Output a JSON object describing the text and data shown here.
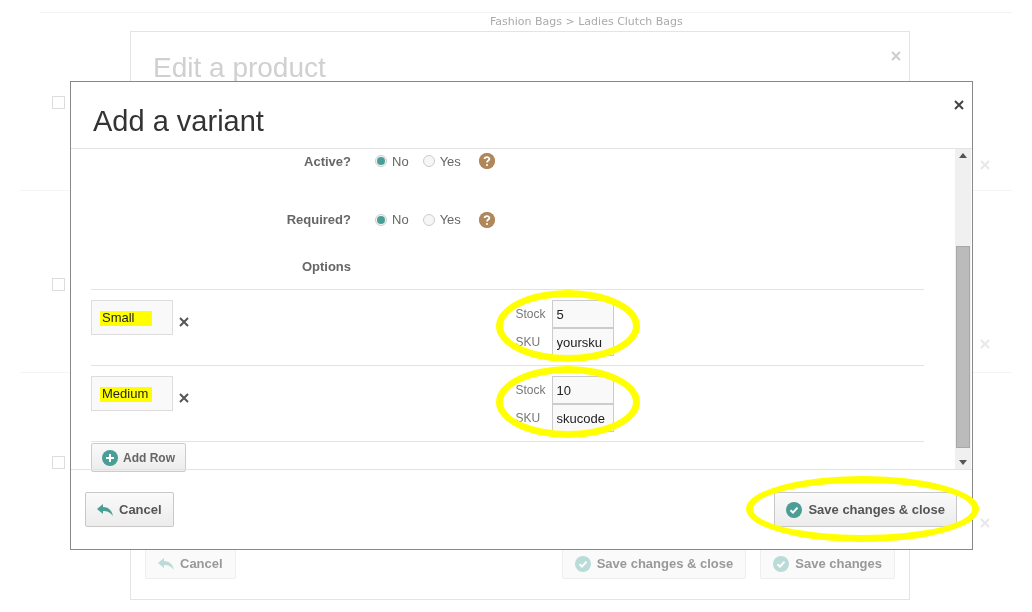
{
  "background": {
    "breadcrumb": "Fashion Bags > Ladies Clutch Bags",
    "rows": [
      {
        "checked": false
      },
      {
        "checked": false
      },
      {
        "checked": false
      }
    ],
    "dialog": {
      "title": "Edit a product",
      "buttons": [
        {
          "label": "Cancel",
          "kind": "cancel"
        },
        {
          "label": "Save changes & close",
          "kind": "save"
        },
        {
          "label": "Save changes",
          "kind": "save"
        }
      ]
    }
  },
  "modal": {
    "title": "Add a variant",
    "settings": [
      {
        "label": "Active?",
        "options": [
          {
            "label": "No",
            "selected": true
          },
          {
            "label": "Yes",
            "selected": false
          }
        ]
      },
      {
        "label": "Required?",
        "options": [
          {
            "label": "No",
            "selected": true
          },
          {
            "label": "Yes",
            "selected": false
          }
        ]
      }
    ],
    "options_label": "Options",
    "option_rows": [
      {
        "name": "Small",
        "name_highlighted": true,
        "stock_label": "Stock",
        "stock": "5",
        "sku_label": "SKU",
        "sku": "yoursku",
        "circled": true
      },
      {
        "name": "Medium",
        "name_highlighted": true,
        "stock_label": "Stock",
        "stock": "10",
        "sku_label": "SKU",
        "sku": "skucode",
        "circled": true
      }
    ],
    "add_row": "Add Row",
    "footer_buttons": [
      {
        "label": "Cancel",
        "kind": "cancel",
        "circled": false
      },
      {
        "label": "Save changes & close",
        "kind": "save",
        "circled": true
      }
    ]
  }
}
